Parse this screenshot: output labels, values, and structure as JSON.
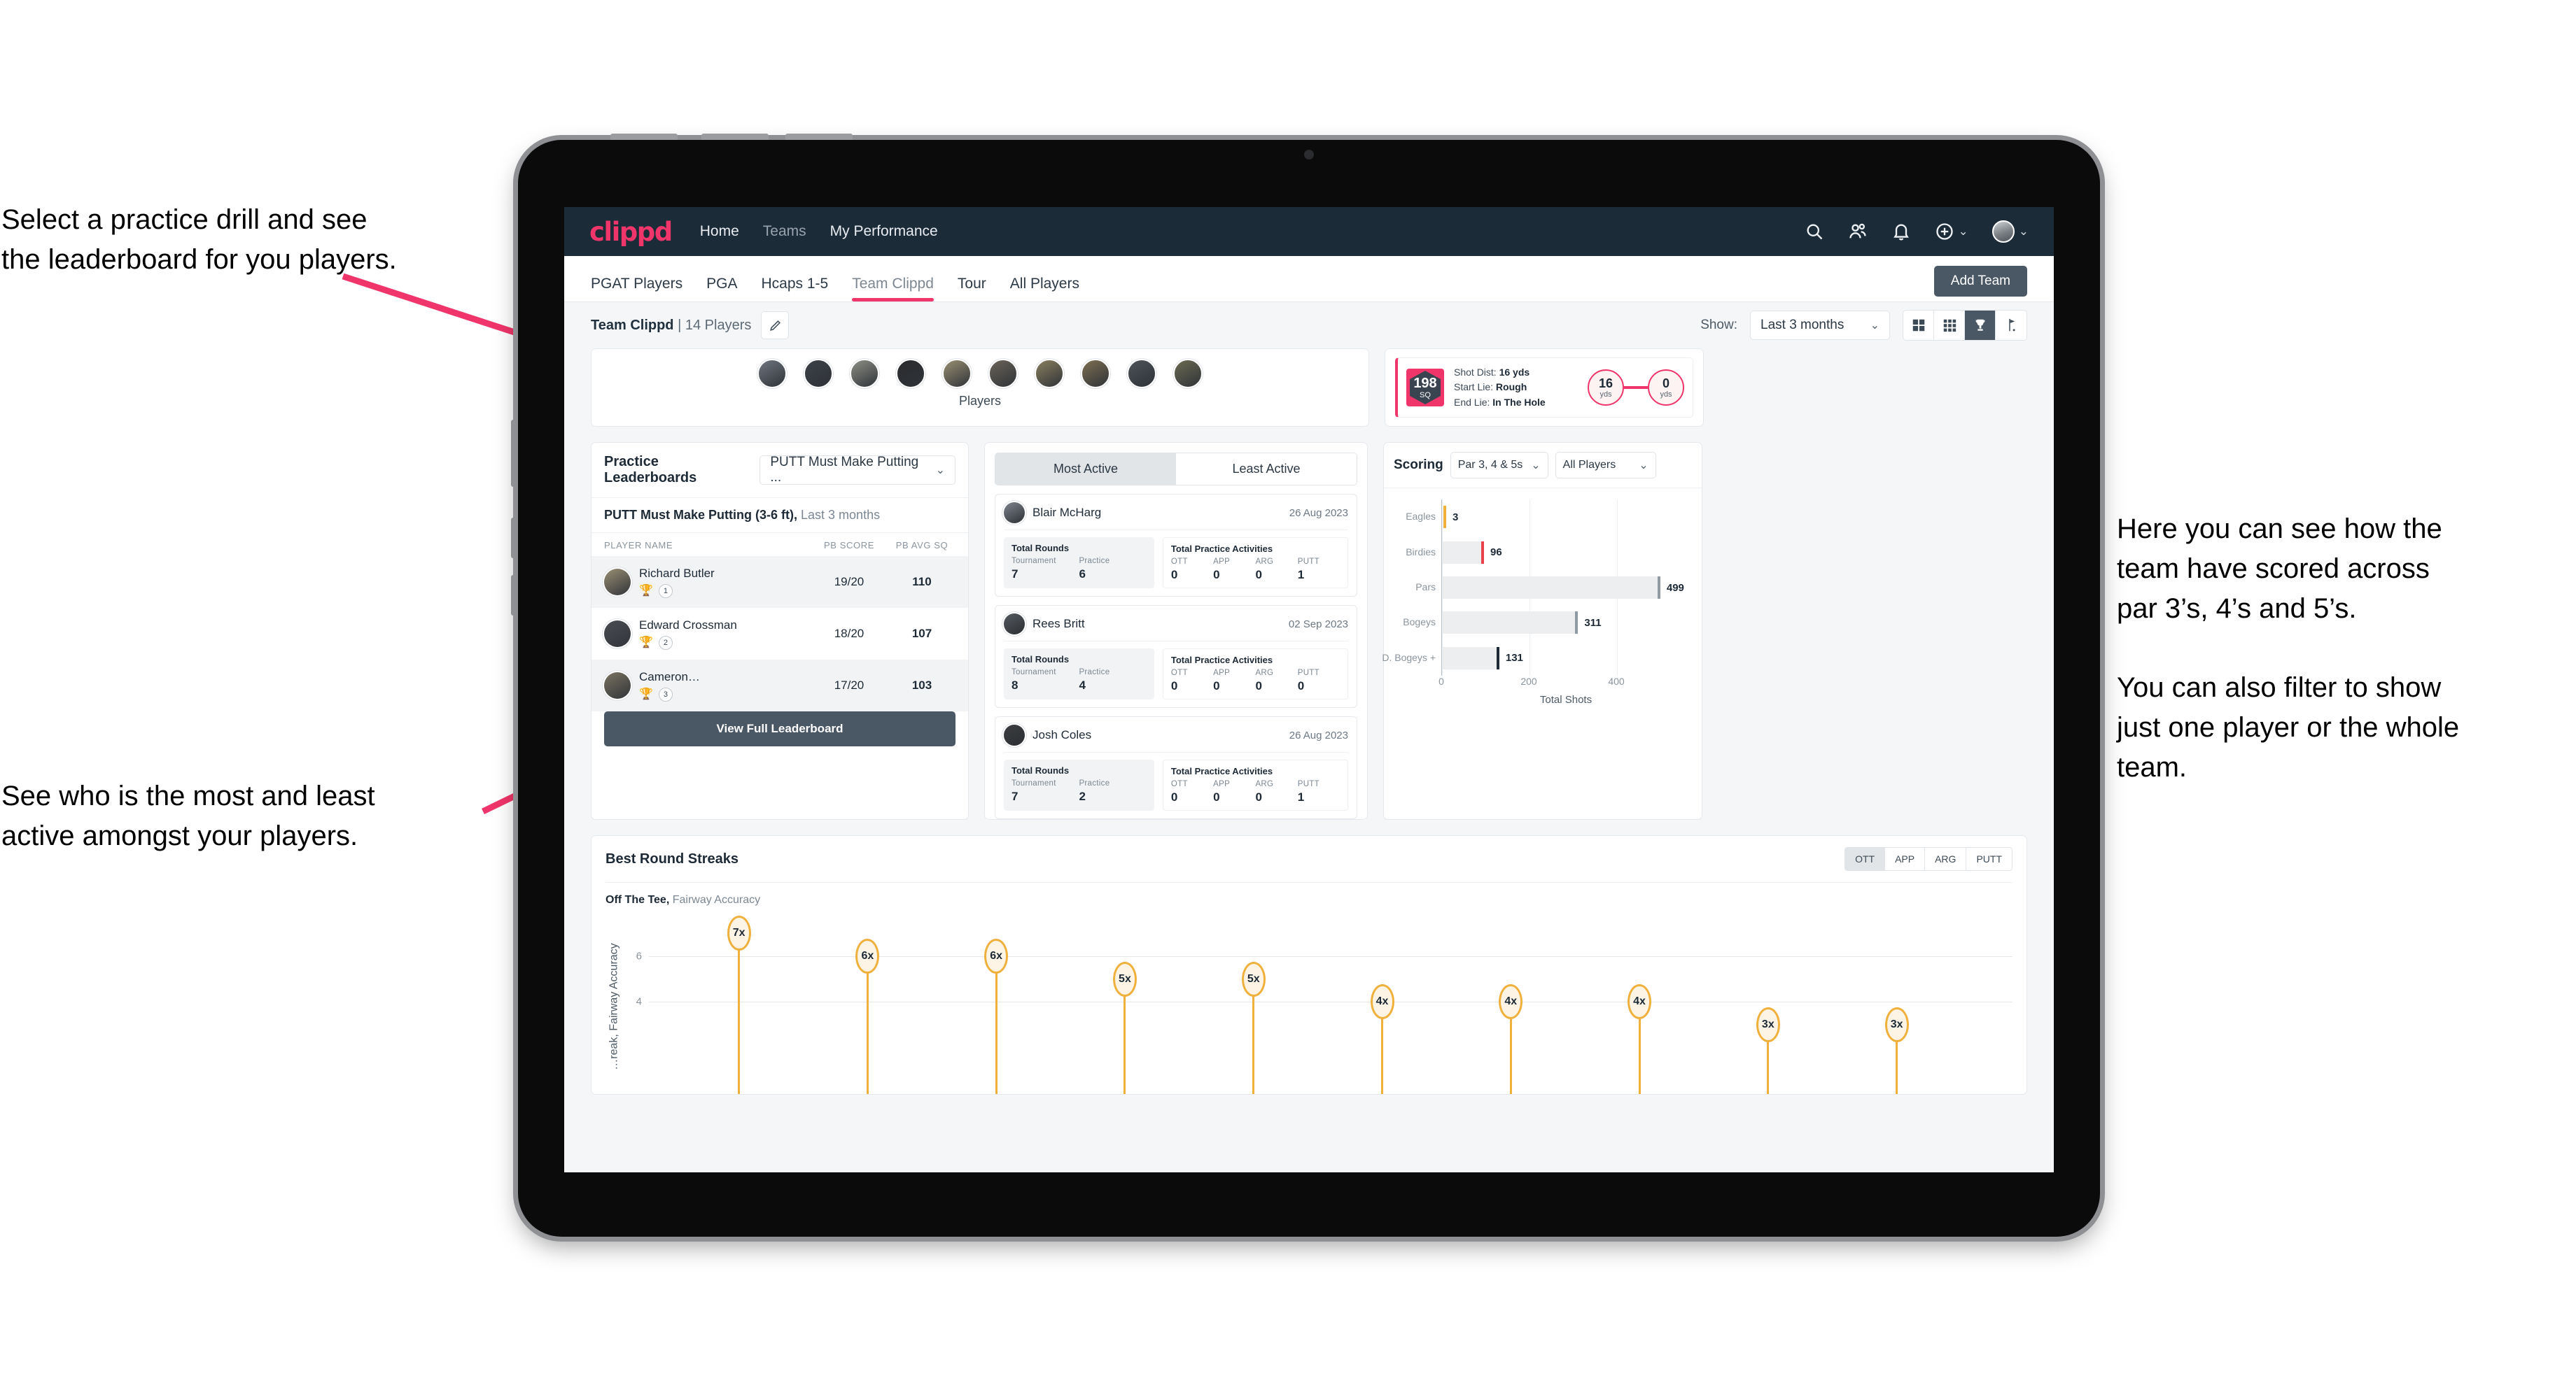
{
  "annotations": {
    "top_left": "Select a practice drill and see\nthe leaderboard for you players.",
    "bottom_left": "See who is the most and least\nactive amongst your players.",
    "right": "Here you can see how the\nteam have scored across\npar 3’s, 4’s and 5’s.\n\nYou can also filter to show\njust one player or the whole\nteam."
  },
  "topnav": {
    "brand": "clippd",
    "links": [
      {
        "label": "Home",
        "dim": false
      },
      {
        "label": "Teams",
        "dim": true
      },
      {
        "label": "My Performance",
        "dim": false
      }
    ],
    "icons": [
      "search-icon",
      "people-icon",
      "bell-icon",
      "plus-circle-icon",
      "avatar"
    ],
    "caret": "⌄"
  },
  "tabbar": {
    "tabs": [
      {
        "label": "PGAT Players",
        "active": false
      },
      {
        "label": "PGA",
        "active": false
      },
      {
        "label": "Hcaps 1-5",
        "active": false
      },
      {
        "label": "Team Clippd",
        "active": true
      },
      {
        "label": "Tour",
        "active": false
      },
      {
        "label": "All Players",
        "active": false
      }
    ],
    "add_team_label": "Add Team"
  },
  "subbar": {
    "team_name": "Team Clippd",
    "separator": "|",
    "player_count": "14 Players",
    "edit_icon": "pencil-icon",
    "show_label": "Show:",
    "range_value": "Last 3 months",
    "view_toggles": [
      {
        "name": "grid-large-icon",
        "active": false
      },
      {
        "name": "grid-small-icon",
        "active": false
      },
      {
        "name": "trophy-icon",
        "active": true
      },
      {
        "name": "golf-flag-icon",
        "active": false
      }
    ]
  },
  "players_strip": {
    "caption": "Players",
    "avatar_count": 10,
    "avatar_colors": [
      "#6f7680",
      "#3c4048",
      "#8d8f85",
      "#2a2b2e",
      "#9a8f73",
      "#6a6358",
      "#8a7f5e",
      "#7e6f52",
      "#4d5259",
      "#6c6a52"
    ]
  },
  "shot_card": {
    "sq_value": "198",
    "sq_unit": "SQ",
    "lines": [
      {
        "label": "Shot Dist:",
        "value": "16 yds"
      },
      {
        "label": "Start Lie:",
        "value": "Rough"
      },
      {
        "label": "End Lie:",
        "value": "In The Hole"
      }
    ],
    "start_value": "16",
    "start_unit": "yds",
    "end_value": "0",
    "end_unit": "yds"
  },
  "leaderboard": {
    "title": "Practice Leaderboards",
    "drill_select": "PUTT Must Make Putting ...",
    "subtitle_bold": "PUTT Must Make Putting (3-6 ft),",
    "subtitle_light": "Last 3 months",
    "columns": [
      "PLAYER NAME",
      "PB SCORE",
      "PB AVG SQ"
    ],
    "rows": [
      {
        "name": "Richard Butler",
        "rank": "1",
        "trophy": "🏆",
        "score": "19/20",
        "sq": "110",
        "avatar": "#9a8f73"
      },
      {
        "name": "Edward Crossman",
        "rank": "2",
        "trophy": "🏆",
        "score": "18/20",
        "sq": "107",
        "avatar": "#4a4d52"
      },
      {
        "name": "Cameron…",
        "rank": "3",
        "trophy": "🏆",
        "score": "17/20",
        "sq": "103",
        "avatar": "#7a7360"
      }
    ],
    "button_label": "View Full Leaderboard"
  },
  "activity": {
    "tabs": [
      {
        "label": "Most Active",
        "active": true
      },
      {
        "label": "Least Active",
        "active": false
      }
    ],
    "stat_titles": {
      "rounds": "Total Rounds",
      "practice": "Total Practice Activities"
    },
    "rounds_labels": [
      "Tournament",
      "Practice"
    ],
    "practice_labels": [
      "OTT",
      "APP",
      "ARG",
      "PUTT"
    ],
    "items": [
      {
        "name": "Blair McHarg",
        "date": "26 Aug 2023",
        "tournament": "7",
        "practice": "6",
        "ott": "0",
        "app": "0",
        "arg": "0",
        "putt": "1",
        "avatar": "#7f8590"
      },
      {
        "name": "Rees Britt",
        "date": "02 Sep 2023",
        "tournament": "8",
        "practice": "4",
        "ott": "0",
        "app": "0",
        "arg": "0",
        "putt": "0",
        "avatar": "#555a60"
      },
      {
        "name": "Josh Coles",
        "date": "26 Aug 2023",
        "tournament": "7",
        "practice": "2",
        "ott": "0",
        "app": "0",
        "arg": "0",
        "putt": "1",
        "avatar": "#3b3d40"
      }
    ]
  },
  "scoring": {
    "title": "Scoring",
    "par_filter": "Par 3, 4 & 5s",
    "player_filter": "All Players"
  },
  "streaks": {
    "title": "Best Round Streaks",
    "buttons": [
      {
        "label": "OTT",
        "active": true
      },
      {
        "label": "APP",
        "active": false
      },
      {
        "label": "ARG",
        "active": false
      },
      {
        "label": "PUTT",
        "active": false
      }
    ],
    "subtitle_bold": "Off The Tee,",
    "subtitle_light": "Fairway Accuracy"
  },
  "chart_data": [
    {
      "type": "bar",
      "orientation": "horizontal",
      "title": "Scoring",
      "categories": [
        "Eagles",
        "Birdies",
        "Pars",
        "Bogeys",
        "D. Bogeys +"
      ],
      "values": [
        3,
        96,
        499,
        311,
        131
      ],
      "cap_colors": [
        "#f0b03c",
        "#e8414a",
        "#8f9aa3",
        "#8f9aa3",
        "#1d2a36"
      ],
      "bar_color": "#eceef0",
      "xlabel": "Total Shots",
      "ylabel": "",
      "xlim": [
        0,
        560
      ],
      "xticks": [
        0,
        200,
        400
      ],
      "grid": true,
      "legend": "none"
    },
    {
      "type": "scatter",
      "title": "Best Round Streaks",
      "subtitle": "Off The Tee, Fairway Accuracy",
      "ylabel": "…reak, Fairway Accuracy",
      "xlabel": "",
      "ylim": [
        0,
        7.6
      ],
      "yticks": [
        4,
        6
      ],
      "grid": true,
      "marker_style": "lollipop-bubble",
      "marker_color": "#f0b03c",
      "categories": [
        "p1",
        "p2",
        "p3",
        "p4",
        "p5",
        "p6",
        "p7",
        "p8",
        "p9",
        "p10"
      ],
      "values": [
        7,
        6,
        6,
        5,
        5,
        4,
        4,
        4,
        3,
        3
      ],
      "labels": [
        "7x",
        "6x",
        "6x",
        "5x",
        "5x",
        "4x",
        "4x",
        "4x",
        "3x",
        "3x"
      ]
    }
  ]
}
